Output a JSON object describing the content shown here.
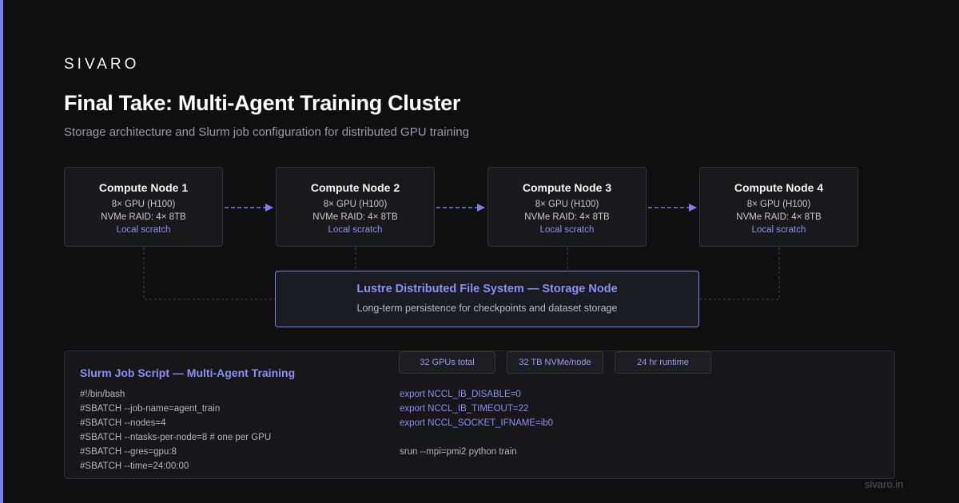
{
  "brand": "SIVARO",
  "title": "Final Take: Multi-Agent Training Cluster",
  "subtitle": "Storage architecture and Slurm job configuration for distributed GPU training",
  "nodes": [
    {
      "name": "Compute Node 1",
      "gpu": "8× GPU (H100)",
      "nvme": "NVMe RAID: 4× 8TB",
      "scratch": "Local scratch"
    },
    {
      "name": "Compute Node 2",
      "gpu": "8× GPU (H100)",
      "nvme": "NVMe RAID: 4× 8TB",
      "scratch": "Local scratch"
    },
    {
      "name": "Compute Node 3",
      "gpu": "8× GPU (H100)",
      "nvme": "NVMe RAID: 4× 8TB",
      "scratch": "Local scratch"
    },
    {
      "name": "Compute Node 4",
      "gpu": "8× GPU (H100)",
      "nvme": "NVMe RAID: 4× 8TB",
      "scratch": "Local scratch"
    }
  ],
  "storage": {
    "title": "Lustre Distributed File System — Storage Node",
    "desc": "Long-term persistence for checkpoints and dataset storage"
  },
  "badges": [
    "32 GPUs total",
    "32 TB NVMe/node",
    "24 hr runtime"
  ],
  "slurm": {
    "title": "Slurm Job Script — Multi-Agent Training",
    "left_lines": [
      "#!/bin/bash",
      "#SBATCH --job-name=agent_train",
      "#SBATCH --nodes=4",
      "#SBATCH --ntasks-per-node=8 # one per GPU",
      "#SBATCH --gres=gpu:8",
      "#SBATCH --time=24:00:00"
    ],
    "right_lines": [
      "export NCCL_IB_DISABLE=0",
      "export NCCL_IB_TIMEOUT=22",
      "export NCCL_SOCKET_IFNAME=ib0",
      "",
      "srun --mpi=pmi2 python train"
    ]
  },
  "footer": "sivaro.in",
  "colors": {
    "accent": "#7b7ff0",
    "background": "#0f0f10",
    "panel": "#19191c"
  }
}
